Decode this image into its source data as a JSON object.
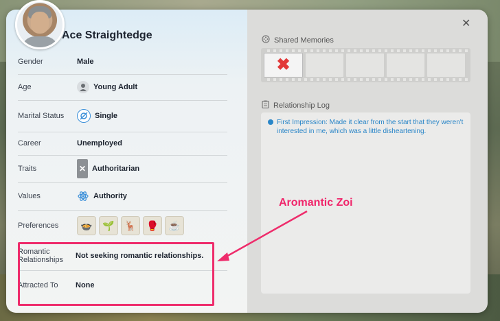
{
  "profile": {
    "name": "Ace Straightedge",
    "rows": [
      {
        "label": "Gender",
        "value": "Male"
      },
      {
        "label": "Age",
        "value": "Young Adult",
        "icon": "person-icon"
      },
      {
        "label": "Marital Status",
        "value": "Single",
        "icon": "single-icon"
      },
      {
        "label": "Career",
        "value": "Unemployed"
      },
      {
        "label": "Traits",
        "value": "Authoritarian",
        "icon": "trait-card-icon"
      },
      {
        "label": "Values",
        "value": "Authority",
        "icon": "atom-icon"
      },
      {
        "label": "Preferences",
        "value": ""
      },
      {
        "label": "Romantic Relationships",
        "value": "Not seeking romantic relationships."
      },
      {
        "label": "Attracted To",
        "value": "None"
      }
    ],
    "preferences": [
      "bowl-food-icon",
      "plant-icon",
      "deer-icon",
      "boxing-glove-icon",
      "coffee-icon"
    ]
  },
  "memories": {
    "title": "Shared Memories",
    "slots": [
      "x-mark-icon",
      "",
      "",
      "",
      ""
    ]
  },
  "log": {
    "title": "Relationship Log",
    "entries": [
      "First Impression: Made it clear from the start that they weren't interested in me, which was a little disheartening."
    ]
  },
  "annotation": {
    "text": "Aromantic Zoi",
    "color": "#f0266b"
  },
  "colors": {
    "highlight": "#ee2c6b",
    "log_text": "#2a86c8"
  }
}
